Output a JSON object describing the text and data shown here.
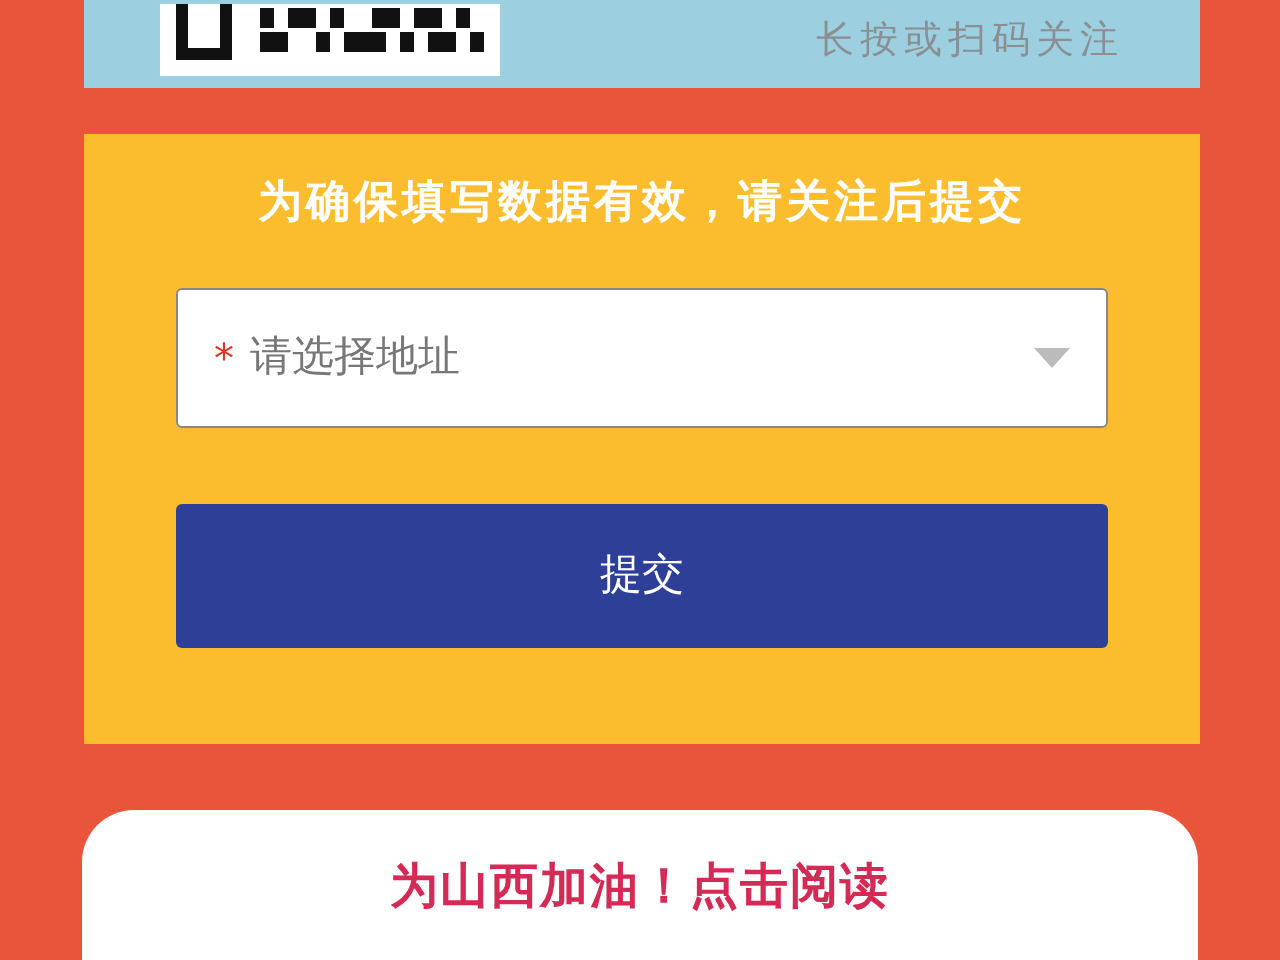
{
  "banner": {
    "caption": "长按或扫码关注"
  },
  "form": {
    "title": "为确保填写数据有效，请关注后提交",
    "address_select": {
      "required_mark": "*",
      "placeholder": "请选择地址"
    },
    "submit_button": "提交"
  },
  "article_card": {
    "title": "为山西加油！点击阅读"
  }
}
